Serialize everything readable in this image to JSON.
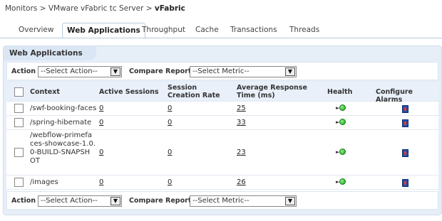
{
  "breadcrumb": {
    "path": "Monitors > VMware vFabric tc Server > ",
    "current": "vFabric"
  },
  "tabs": [
    {
      "label": "Overview"
    },
    {
      "label": "Web Applications"
    },
    {
      "label": "Throughput"
    },
    {
      "label": "Cache"
    },
    {
      "label": "Transactions"
    },
    {
      "label": "Threads"
    }
  ],
  "active_tab": "Web Applications",
  "panel": {
    "title": "Web Applications"
  },
  "action_bar": {
    "action_label": "Action",
    "action_select": "--Select Action--",
    "compare_label": "Compare Reports",
    "metric_select": "--Select Metric--"
  },
  "table": {
    "headers": {
      "context": "Context",
      "active_sessions": "Active Sessions",
      "session_creation_rate": "Session Creation Rate",
      "avg_response_time": "Average Response Time  (ms)",
      "health": "Health",
      "configure_alarms": "Configure Alarms"
    },
    "rows": [
      {
        "context": "/swf-booking-faces",
        "active_sessions": "0",
        "session_creation_rate": "0",
        "avg_response_time": "25",
        "health": "green"
      },
      {
        "context": "/spring-hibernate",
        "active_sessions": "0",
        "session_creation_rate": "0",
        "avg_response_time": "33",
        "health": "green"
      },
      {
        "context": "/webflow-primefaces-showcase-1.0.0-BUILD-SNAPSHOT",
        "active_sessions": "0",
        "session_creation_rate": "0",
        "avg_response_time": "23",
        "health": "green"
      },
      {
        "context": "/images",
        "active_sessions": "0",
        "session_creation_rate": "0",
        "avg_response_time": "26",
        "health": "green"
      }
    ]
  },
  "icons": {
    "health": "health-ok-icon",
    "alarm": "configure-alarm-icon",
    "dropdown": "chevron-down-icon"
  },
  "colors": {
    "panel_bg": "#e6eef8",
    "header_bg": "#e9f0fa",
    "health_ok": "#1b9e1b",
    "alarm_icon": "#1f4fa8"
  }
}
